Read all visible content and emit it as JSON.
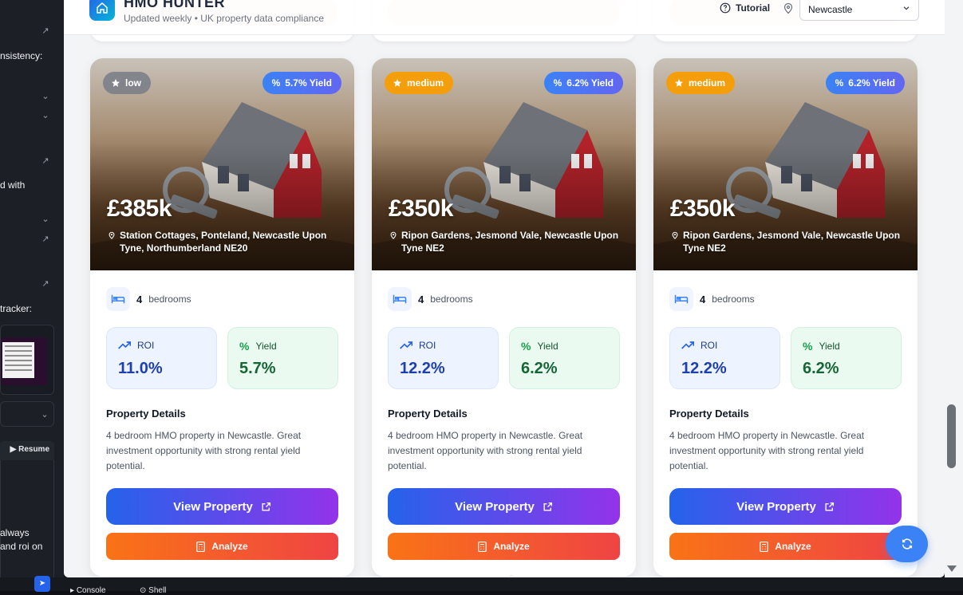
{
  "ide": {
    "left_snippets": [
      "nsistency:",
      "d with",
      "tracker:",
      "always",
      "and roi on"
    ],
    "resume_label": "Resume",
    "bottom_tabs": [
      "Console",
      "Shell"
    ]
  },
  "header": {
    "title": "HMO HUNTER",
    "subtitle": "Updated weekly • UK property data compliance",
    "tutorial_label": "Tutorial",
    "city": "Newcastle"
  },
  "cards": [
    {
      "risk": "low",
      "yield_badge": "5.7% Yield",
      "price": "£385k",
      "address": "Station Cottages, Ponteland, Newcastle Upon Tyne, Northumberland NE20",
      "bedrooms": "4",
      "bedrooms_label": "bedrooms",
      "roi_label": "ROI",
      "roi": "11.0%",
      "yield_label": "Yield",
      "yield": "5.7%",
      "details_title": "Property Details",
      "details": "4 bedroom HMO property in Newcastle. Great investment opportunity with strong rental yield potential.",
      "view_label": "View Property",
      "analyze_label": "Analyze"
    },
    {
      "risk": "medium",
      "yield_badge": "6.2% Yield",
      "price": "£350k",
      "address": "Ripon Gardens, Jesmond Vale, Newcastle Upon Tyne NE2",
      "bedrooms": "4",
      "bedrooms_label": "bedrooms",
      "roi_label": "ROI",
      "roi": "12.2%",
      "yield_label": "Yield",
      "yield": "6.2%",
      "details_title": "Property Details",
      "details": "4 bedroom HMO property in Newcastle. Great investment opportunity with strong rental yield potential.",
      "view_label": "View Property",
      "analyze_label": "Analyze"
    },
    {
      "risk": "medium",
      "yield_badge": "6.2% Yield",
      "price": "£350k",
      "address": "Ripon Gardens, Jesmond Vale, Newcastle Upon Tyne NE2",
      "bedrooms": "4",
      "bedrooms_label": "bedrooms",
      "roi_label": "ROI",
      "roi": "12.2%",
      "yield_label": "Yield",
      "yield": "6.2%",
      "details_title": "Property Details",
      "details": "4 bedroom HMO property in Newcastle. Great investment opportunity with strong rental yield potential.",
      "view_label": "View Property",
      "analyze_label": "Analyze"
    }
  ]
}
